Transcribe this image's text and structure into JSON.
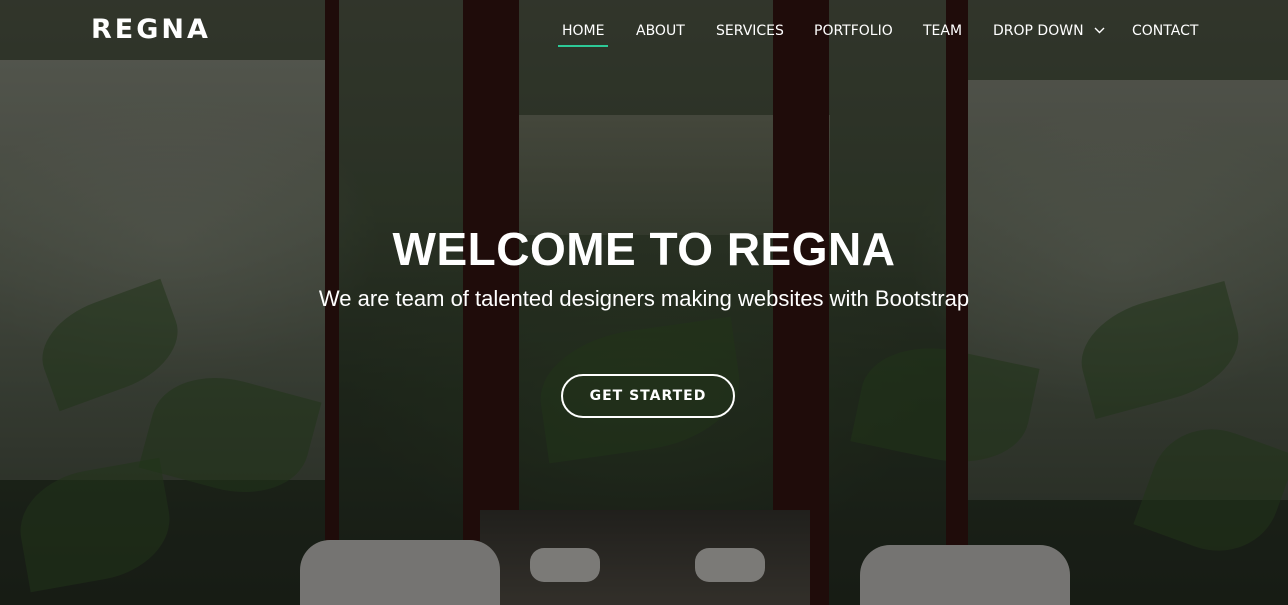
{
  "header": {
    "logo": "REGNA",
    "nav": [
      {
        "label": "HOME",
        "active": true
      },
      {
        "label": "ABOUT"
      },
      {
        "label": "SERVICES"
      },
      {
        "label": "PORTFOLIO"
      },
      {
        "label": "TEAM"
      },
      {
        "label": "DROP DOWN",
        "icon": "chevron-down-icon"
      },
      {
        "label": "CONTACT"
      }
    ]
  },
  "hero": {
    "title": "WELCOME TO REGNA",
    "subtitle": "We are team of talented designers making websites with Bootstrap",
    "cta_label": "GET STARTED"
  },
  "colors": {
    "accent": "#2dc997",
    "text": "#ffffff"
  }
}
